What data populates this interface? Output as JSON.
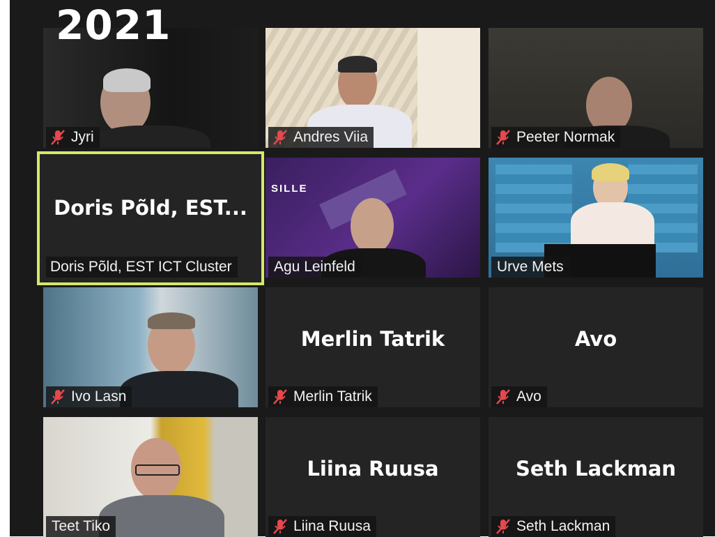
{
  "overlay": {
    "year": "2021"
  },
  "accent_color": "#d6e86a",
  "mute_icon_color": "#e5484d",
  "participants": [
    {
      "name": "Jyri",
      "muted": true
    },
    {
      "name": "Andres Viia",
      "muted": true
    },
    {
      "name": "Peeter Normak",
      "muted": true
    },
    {
      "name": "Doris Põld, EST ICT Cluster",
      "tile_name": "Doris Põld, EST...",
      "muted": false,
      "active_speaker": true
    },
    {
      "name": "Agu Leinfeld",
      "muted": false,
      "background_text": "SILLE"
    },
    {
      "name": "Urve Mets",
      "muted": false
    },
    {
      "name": "Ivo Lasn",
      "muted": true
    },
    {
      "name": "Merlin Tatrik",
      "tile_name": "Merlin Tatrik",
      "muted": true
    },
    {
      "name": "Avo",
      "tile_name": "Avo",
      "muted": true
    },
    {
      "name": "Teet Tiko",
      "muted": false
    },
    {
      "name": "Liina Ruusa",
      "tile_name": "Liina Ruusa",
      "muted": true
    },
    {
      "name": "Seth Lackman",
      "tile_name": "Seth Lackman",
      "muted": true
    }
  ]
}
